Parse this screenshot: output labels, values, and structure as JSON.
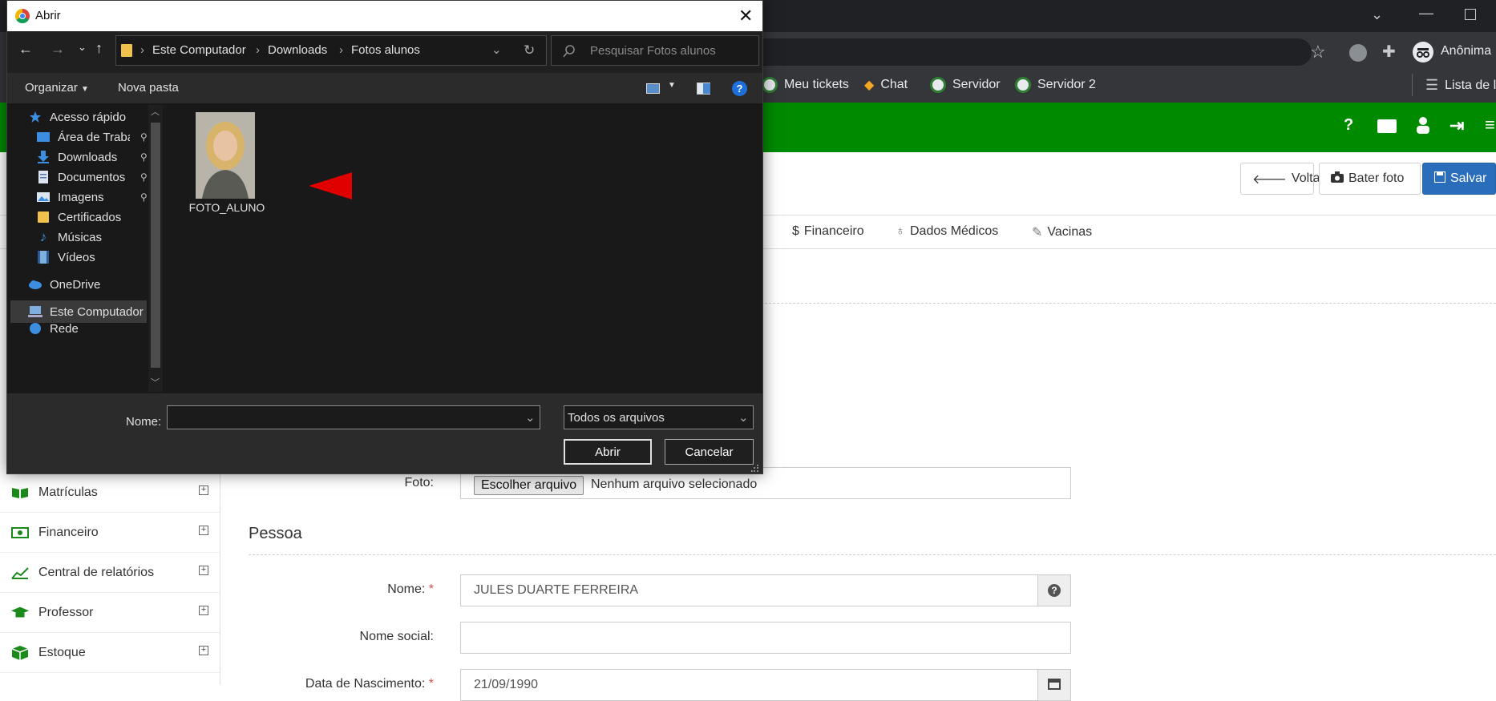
{
  "browser": {
    "profile_label": "Anônima",
    "bookmarks": [
      {
        "label": "Meu tickets"
      },
      {
        "label": "Chat"
      },
      {
        "label": "Servidor"
      },
      {
        "label": "Servidor 2"
      }
    ],
    "reading_list_label": "Lista de l"
  },
  "page": {
    "actions": {
      "back": "Voltar",
      "photo": "Bater foto",
      "save": "Salvar"
    },
    "tabs": [
      {
        "label": "Financeiro",
        "icon": "dollar-icon"
      },
      {
        "label": "Dados Médicos",
        "icon": "stethoscope-icon"
      },
      {
        "label": "Vacinas",
        "icon": "syringe-icon"
      }
    ],
    "sidebar": [
      {
        "label": "Matrículas",
        "icon": "book-icon"
      },
      {
        "label": "Financeiro",
        "icon": "money-icon"
      },
      {
        "label": "Central de relatórios",
        "icon": "chart-icon"
      },
      {
        "label": "Professor",
        "icon": "graduation-cap-icon"
      },
      {
        "label": "Estoque",
        "icon": "box-icon"
      }
    ],
    "form": {
      "foto_label": "Foto:",
      "file_button": "Escolher arquivo",
      "file_status": "Nenhum arquivo selecionado",
      "section_pessoa": "Pessoa",
      "nome_label": "Nome:",
      "nome_value": "JULES DUARTE FERREIRA",
      "nome_social_label": "Nome social:",
      "nome_social_value": "",
      "nascimento_label": "Data de Nascimento:",
      "nascimento_value": "21/09/1990",
      "required_mark": "*"
    },
    "colors": {
      "brand_green": "#008a00",
      "primary_blue": "#2a6ebb",
      "annotation_red": "#e00000"
    }
  },
  "dialog": {
    "title": "Abrir",
    "breadcrumb": [
      "Este Computador",
      "Downloads",
      "Fotos alunos"
    ],
    "search_placeholder": "Pesquisar Fotos alunos",
    "toolbar": {
      "organize": "Organizar",
      "new_folder": "Nova pasta"
    },
    "nav_items": [
      {
        "label": "Acesso rápido",
        "icon": "star-icon",
        "pinned": false
      },
      {
        "label": "Área de Traba",
        "icon": "desktop-icon",
        "pinned": true
      },
      {
        "label": "Downloads",
        "icon": "download-icon",
        "pinned": true
      },
      {
        "label": "Documentos",
        "icon": "document-icon",
        "pinned": true
      },
      {
        "label": "Imagens",
        "icon": "image-icon",
        "pinned": true
      },
      {
        "label": "Certificados",
        "icon": "folder-icon",
        "pinned": false
      },
      {
        "label": "Músicas",
        "icon": "music-icon",
        "pinned": false
      },
      {
        "label": "Vídeos",
        "icon": "video-icon",
        "pinned": false
      },
      {
        "label": "OneDrive",
        "icon": "cloud-icon",
        "pinned": false
      },
      {
        "label": "Este Computador",
        "icon": "computer-icon",
        "pinned": false
      },
      {
        "label": "Rede",
        "icon": "network-icon",
        "pinned": false
      }
    ],
    "files": [
      {
        "name": "FOTO_ALUNO",
        "type": "image"
      }
    ],
    "filename_label": "Nome:",
    "filename_value": "",
    "filter_value": "Todos os arquivos",
    "open_label": "Abrir",
    "cancel_label": "Cancelar"
  }
}
